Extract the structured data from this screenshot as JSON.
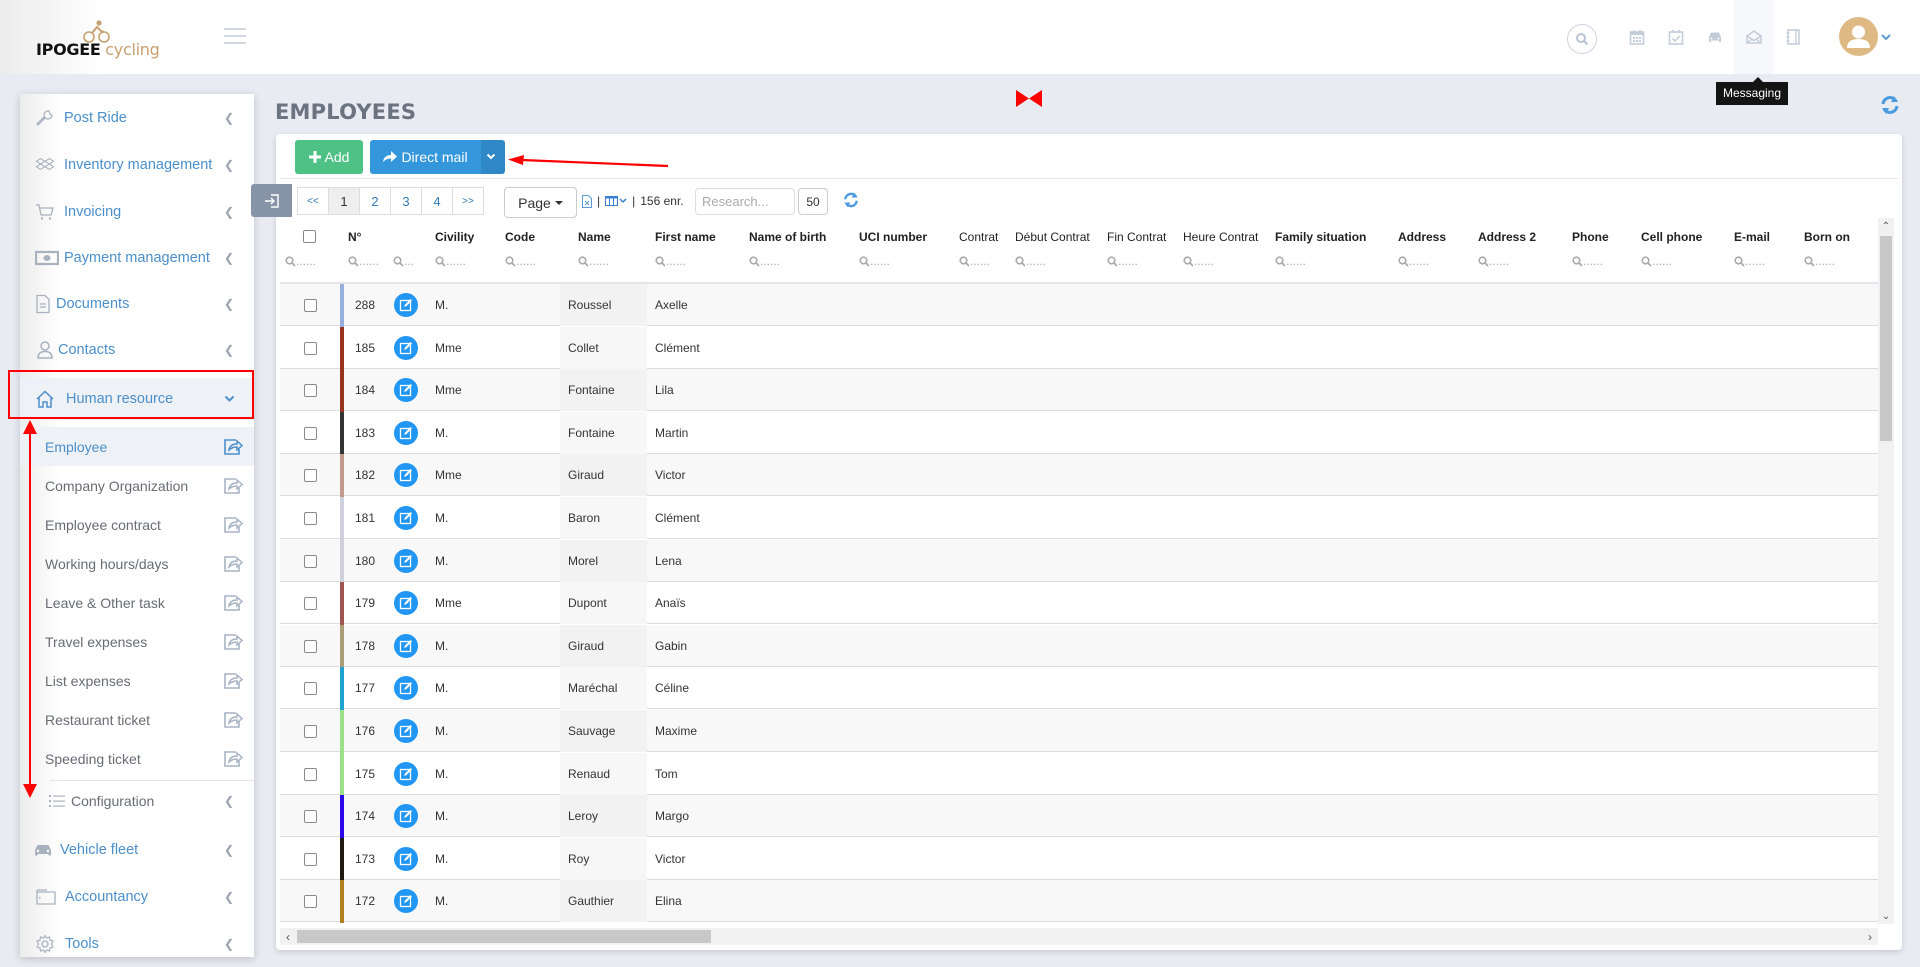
{
  "brand": {
    "name_part1": "IPOGEE",
    "name_part2": "cycling"
  },
  "top_icons": [
    "search-icon",
    "calendar-icon",
    "calendar-check-icon",
    "car-icon",
    "envelope-open-icon",
    "notebook-icon"
  ],
  "tooltip": "Messaging",
  "sidebar": {
    "items": [
      {
        "label": "Post Ride",
        "icon": "wrench-icon"
      },
      {
        "label": "Inventory management",
        "icon": "dropbox-icon"
      },
      {
        "label": "Invoicing",
        "icon": "cart-icon"
      },
      {
        "label": "Payment management",
        "icon": "money-icon"
      },
      {
        "label": "Documents",
        "icon": "document-icon"
      },
      {
        "label": "Contacts",
        "icon": "user-icon"
      },
      {
        "label": "Human resource",
        "icon": "home-icon",
        "expanded": true
      },
      {
        "label": "Vehicle fleet",
        "icon": "car-icon"
      },
      {
        "label": "Accountancy",
        "icon": "wallet-icon"
      },
      {
        "label": "Tools",
        "icon": "gear-icon"
      }
    ],
    "hr_subitems": [
      {
        "label": "Employee",
        "active": true
      },
      {
        "label": "Company Organization"
      },
      {
        "label": "Employee contract"
      },
      {
        "label": "Working hours/days"
      },
      {
        "label": "Leave & Other task"
      },
      {
        "label": "Travel expenses"
      },
      {
        "label": "List expenses"
      },
      {
        "label": "Restaurant ticket"
      },
      {
        "label": "Speeding ticket"
      }
    ],
    "configuration_label": "Configuration"
  },
  "page": {
    "title": "EMPLOYEES",
    "add_label": "Add",
    "direct_mail_label": "Direct mail"
  },
  "pager": {
    "first": "<<",
    "pages": [
      "1",
      "2",
      "3",
      "4"
    ],
    "current": "1",
    "last": ">>",
    "page_dropdown": "Page",
    "records": "156 enr.",
    "search_placeholder": "Research...",
    "per_page": "50"
  },
  "table": {
    "columns": [
      {
        "key": "no",
        "label": "N°"
      },
      {
        "key": "civility",
        "label": "Civility"
      },
      {
        "key": "code",
        "label": "Code"
      },
      {
        "key": "name",
        "label": "Name"
      },
      {
        "key": "first_name",
        "label": "First name"
      },
      {
        "key": "name_of_birth",
        "label": "Name of birth"
      },
      {
        "key": "uci",
        "label": "UCI number"
      },
      {
        "key": "contrat",
        "label": "Contrat"
      },
      {
        "key": "debut_contrat",
        "label": "Début Contrat"
      },
      {
        "key": "fin_contrat",
        "label": "Fin Contrat"
      },
      {
        "key": "heure_contrat",
        "label": "Heure Contrat"
      },
      {
        "key": "family_situation",
        "label": "Family situation"
      },
      {
        "key": "address",
        "label": "Address"
      },
      {
        "key": "address2",
        "label": "Address 2"
      },
      {
        "key": "phone",
        "label": "Phone"
      },
      {
        "key": "cell_phone",
        "label": "Cell phone"
      },
      {
        "key": "email",
        "label": "E-mail"
      },
      {
        "key": "born_on",
        "label": "Born on"
      }
    ],
    "filter_placeholder": "......",
    "rows": [
      {
        "no": "288",
        "civility": "M.",
        "name": "Roussel",
        "first_name": "Axelle",
        "color": "#98b0dc"
      },
      {
        "no": "185",
        "civility": "Mme",
        "name": "Collet",
        "first_name": "Clément",
        "color": "#96341f"
      },
      {
        "no": "184",
        "civility": "Mme",
        "name": "Fontaine",
        "first_name": "Lila",
        "color": "#96341f"
      },
      {
        "no": "183",
        "civility": "M.",
        "name": "Fontaine",
        "first_name": "Martin",
        "color": "#333333"
      },
      {
        "no": "182",
        "civility": "Mme",
        "name": "Giraud",
        "first_name": "Victor",
        "color": "#c09a8a"
      },
      {
        "no": "181",
        "civility": "M.",
        "name": "Baron",
        "first_name": "Clément",
        "color": "#d0d0dc"
      },
      {
        "no": "180",
        "civility": "M.",
        "name": "Morel",
        "first_name": "Lena",
        "color": "#d0d0dc"
      },
      {
        "no": "179",
        "civility": "Mme",
        "name": "Dupont",
        "first_name": "Anaïs",
        "color": "#a05550"
      },
      {
        "no": "178",
        "civility": "M.",
        "name": "Giraud",
        "first_name": "Gabin",
        "color": "#ab9d78"
      },
      {
        "no": "177",
        "civility": "M.",
        "name": "Maréchal",
        "first_name": "Céline",
        "color": "#1fa2cf"
      },
      {
        "no": "176",
        "civility": "M.",
        "name": "Sauvage",
        "first_name": "Maxime",
        "color": "#9ee08a"
      },
      {
        "no": "175",
        "civility": "M.",
        "name": "Renaud",
        "first_name": "Tom",
        "color": "#9ee08a"
      },
      {
        "no": "174",
        "civility": "M.",
        "name": "Leroy",
        "first_name": "Margo",
        "color": "#2a07e8"
      },
      {
        "no": "173",
        "civility": "M.",
        "name": "Roy",
        "first_name": "Victor",
        "color": "#1e1a10"
      },
      {
        "no": "172",
        "civility": "M.",
        "name": "Gauthier",
        "first_name": "Elina",
        "color": "#b08020"
      }
    ]
  },
  "colors": {
    "accent_blue": "#3497db",
    "add_green": "#4ec285",
    "sidebar_link": "#4b8fcb",
    "edit_icon": "#2196f3",
    "annotation_red": "#ff0000",
    "avatar": "#dfb983"
  }
}
